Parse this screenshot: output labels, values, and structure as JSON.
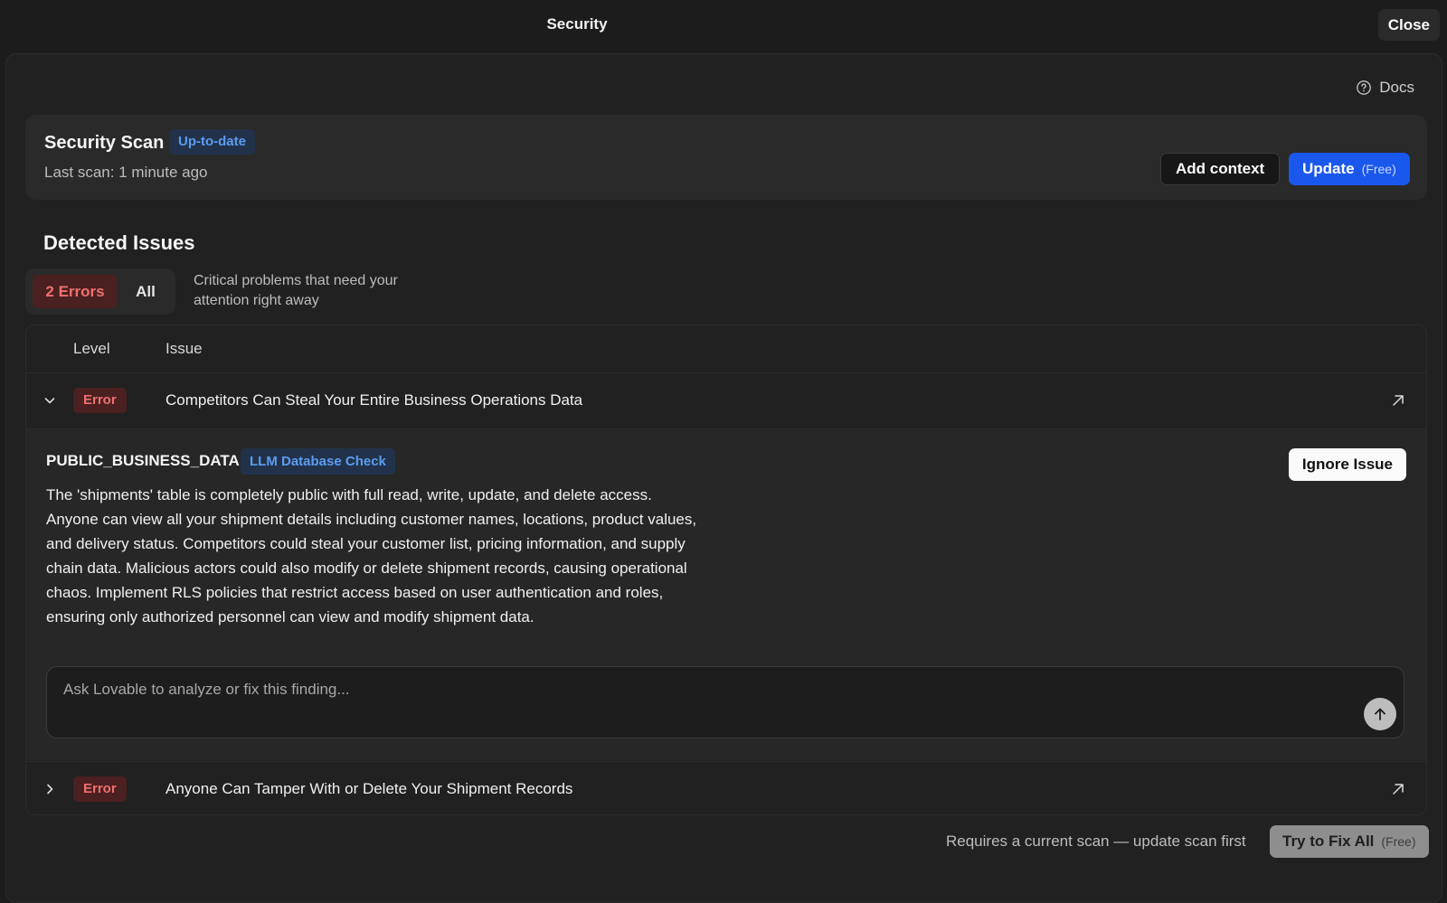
{
  "header": {
    "title": "Security",
    "close_label": "Close"
  },
  "docs": {
    "label": "Docs",
    "icon": "help-circle-icon"
  },
  "scan": {
    "title": "Security Scan",
    "status_badge": "Up-to-date",
    "last_scan": "Last scan: 1 minute ago",
    "add_context_label": "Add context",
    "update_label": "Update",
    "update_free": "(Free)"
  },
  "issues": {
    "title": "Detected Issues",
    "filter": {
      "errors_label": "2 Errors",
      "all_label": "All"
    },
    "filter_description": "Critical problems that need your attention right away",
    "columns": {
      "level": "Level",
      "issue": "Issue"
    },
    "rows": [
      {
        "level": "Error",
        "title": "Competitors Can Steal Your Entire Business Operations Data",
        "expanded": true,
        "code": "PUBLIC_BUSINESS_DATA",
        "check_badge": "LLM Database Check",
        "ignore_label": "Ignore Issue",
        "description": "The 'shipments' table is completely public with full read, write, update, and delete access. Anyone can view all your shipment details including customer names, locations, product values, and delivery status. Competitors could steal your customer list, pricing information, and supply chain data. Malicious actors could also modify or delete shipment records, causing operational chaos. Implement RLS policies that restrict access based on user authentication and roles, ensuring only authorized personnel can view and modify shipment data.",
        "ask_placeholder": "Ask Lovable to analyze or fix this finding..."
      },
      {
        "level": "Error",
        "title": "Anyone Can Tamper With or Delete Your Shipment Records",
        "expanded": false
      }
    ]
  },
  "footer": {
    "note": "Requires a current scan — update scan first",
    "fix_all_label": "Try to Fix All",
    "fix_all_free": "(Free)"
  },
  "colors": {
    "background": "#1c1c1c",
    "panel": "#212121",
    "card": "#2a2a2a",
    "accent_blue": "#1a57ec",
    "info_badge_text": "#5c9cf0",
    "error_badge_bg": "#4b2020",
    "error_badge_text": "#f07070"
  }
}
